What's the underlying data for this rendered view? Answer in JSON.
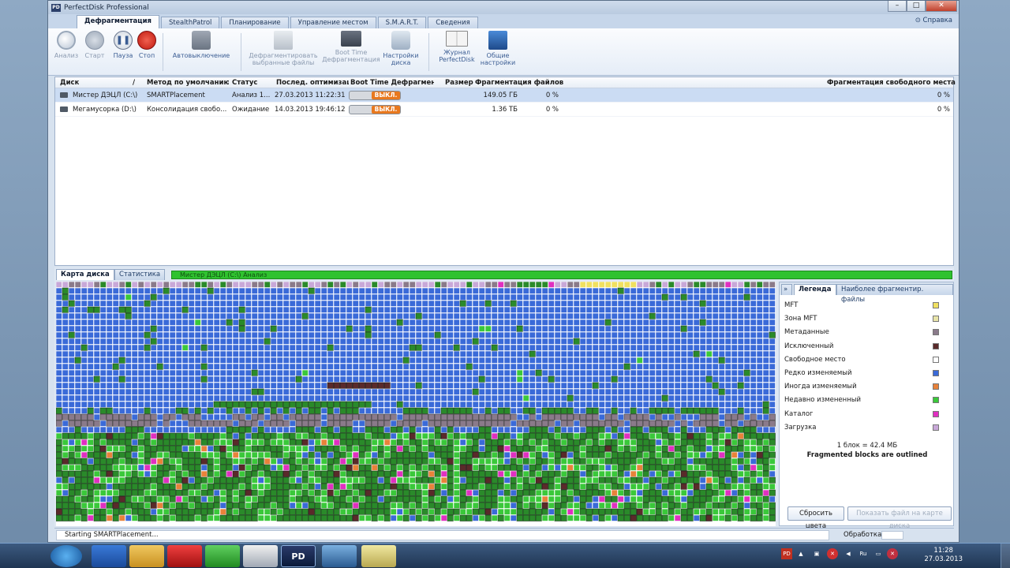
{
  "window": {
    "title": "PerfectDisk Professional",
    "icon_label": "PD"
  },
  "tabs": [
    "Дефрагментация",
    "StealthPatrol",
    "Планирование",
    "Управление местом",
    "S.M.A.R.T.",
    "Сведения"
  ],
  "help_label": "Справка",
  "ribbon": {
    "analyze": "Анализ",
    "start": "Старт",
    "pause": "Пауза",
    "stop": "Стоп",
    "autooff": "Автовыключение",
    "defrag_selected_1": "Дефрагментировать",
    "defrag_selected_2": "выбранные файлы",
    "boot_time_1": "Boot Time",
    "boot_time_2": "Дефрагментация",
    "disk_settings_1": "Настройки",
    "disk_settings_2": "диска",
    "journal_1": "Журнал",
    "journal_2": "PerfectDisk",
    "general_1": "Общие",
    "general_2": "настройки"
  },
  "list": {
    "headers": {
      "disk": "Диск",
      "method": "Метод по умолчанию",
      "status": "Статус",
      "last": "Послед. оптимизац",
      "boot": "Boot Time Дефрагмен",
      "size": "Размер",
      "frag_files": "Фрагментация файлов",
      "frag_free": "Фрагментация свободного места"
    },
    "rows": [
      {
        "disk": "Мистер ДЭЦЛ (C:\\)",
        "method": "SMARTPlacement",
        "status": "Анализ 1...",
        "last": "27.03.2013 11:22:31",
        "boot": "ВЫКЛ.",
        "size": "149.05 ГБ",
        "frag_files": "0 %",
        "frag_free": "0 %"
      },
      {
        "disk": "Мегамусорка (D:\\)",
        "method": "Консолидация свобо...",
        "status": "Ожидание",
        "last": "14.03.2013 19:46:12",
        "boot": "ВЫКЛ.",
        "size": "1.36 ТБ",
        "frag_files": "0 %",
        "frag_free": "0 %"
      }
    ]
  },
  "map": {
    "tab_map": "Карта диска",
    "tab_stats": "Статистика",
    "progress_label": "Мистер ДЭЦЛ (C:\\)  Анализ",
    "progress_fraction": 1.0
  },
  "legend": {
    "expand_label": "»",
    "tab_legend": "Легенда",
    "tab_frag": "Наиболее фрагментир. файлы",
    "items": [
      {
        "label": "MFT",
        "color": "#f0e060"
      },
      {
        "label": "Зона MFT",
        "color": "#e8e4a8"
      },
      {
        "label": "Метаданные",
        "color": "#8a7a8a"
      },
      {
        "label": "Исключенный",
        "color": "#5a2a2a"
      },
      {
        "label": "Свободное место",
        "color": "#ffffff"
      },
      {
        "label": "Редко изменяемый",
        "color": "#3a6ad8"
      },
      {
        "label": "Иногда изменяемый",
        "color": "#e8823a"
      },
      {
        "label": "Недавно измененный",
        "color": "#3ac83a"
      },
      {
        "label": "Каталог",
        "color": "#e030c0"
      },
      {
        "label": "Загрузка",
        "color": "#c8a8d8"
      }
    ],
    "block_size": "1 блок = 42.4 МБ",
    "note": "Fragmented blocks are outlined",
    "reset_colors": "Сбросить цвета",
    "show_file": "Показать файл на карте диска"
  },
  "status": {
    "message": "Starting SMARTPlacement...",
    "processing": "Обработка"
  },
  "taskbar": {
    "time": "11:28",
    "date": "27.03.2013",
    "lang": "Ru",
    "pd_label": "PD"
  },
  "colors": {
    "blue": "#3a6ad8",
    "green": "#3ac83a",
    "darkgreen": "#2a8a2a",
    "dark": "#5a2a2a",
    "meta": "#8a7a8a",
    "orange": "#e8823a",
    "magenta": "#e030c0",
    "lilac": "#c8a8d8",
    "yellow": "#f0e060"
  }
}
